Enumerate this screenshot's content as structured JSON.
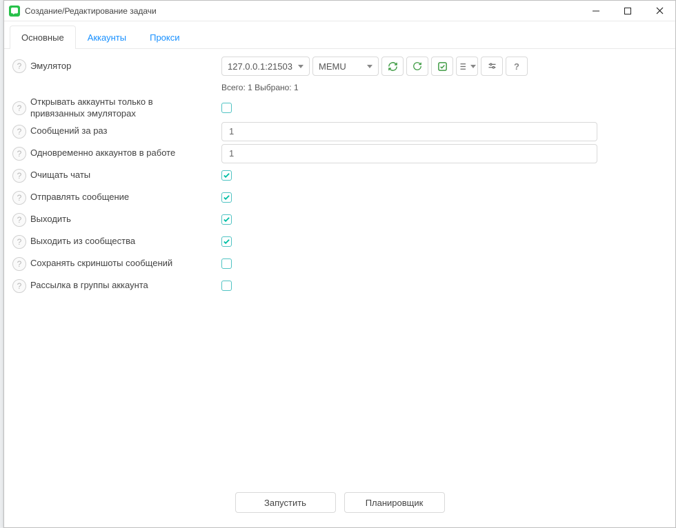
{
  "window": {
    "title": "Создание/Редактирование задачи"
  },
  "tabs": [
    {
      "label": "Основные",
      "active": true
    },
    {
      "label": "Аккаунты",
      "active": false
    },
    {
      "label": "Прокси",
      "active": false
    }
  ],
  "form": {
    "emulator": {
      "label": "Эмулятор",
      "address": "127.0.0.1:21503",
      "platform": "MEMU",
      "status": "Всего: 1 Выбрано: 1"
    },
    "open_in_bound_only": {
      "label": "Открывать аккаунты только в привязанных эмуляторах",
      "checked": false
    },
    "messages_per_run": {
      "label": "Сообщений за раз",
      "value": "1"
    },
    "concurrent_accounts": {
      "label": "Одновременно аккаунтов в работе",
      "value": "1"
    },
    "clear_chats": {
      "label": "Очищать чаты",
      "checked": true
    },
    "send_message": {
      "label": "Отправлять сообщение",
      "checked": true
    },
    "logout": {
      "label": "Выходить",
      "checked": true
    },
    "leave_community": {
      "label": "Выходить из сообщества",
      "checked": true
    },
    "save_screenshots": {
      "label": "Сохранять скриншоты сообщений",
      "checked": false
    },
    "group_mailing": {
      "label": "Рассылка в группы аккаунта",
      "checked": false
    }
  },
  "footer": {
    "run": "Запустить",
    "scheduler": "Планировщик"
  }
}
